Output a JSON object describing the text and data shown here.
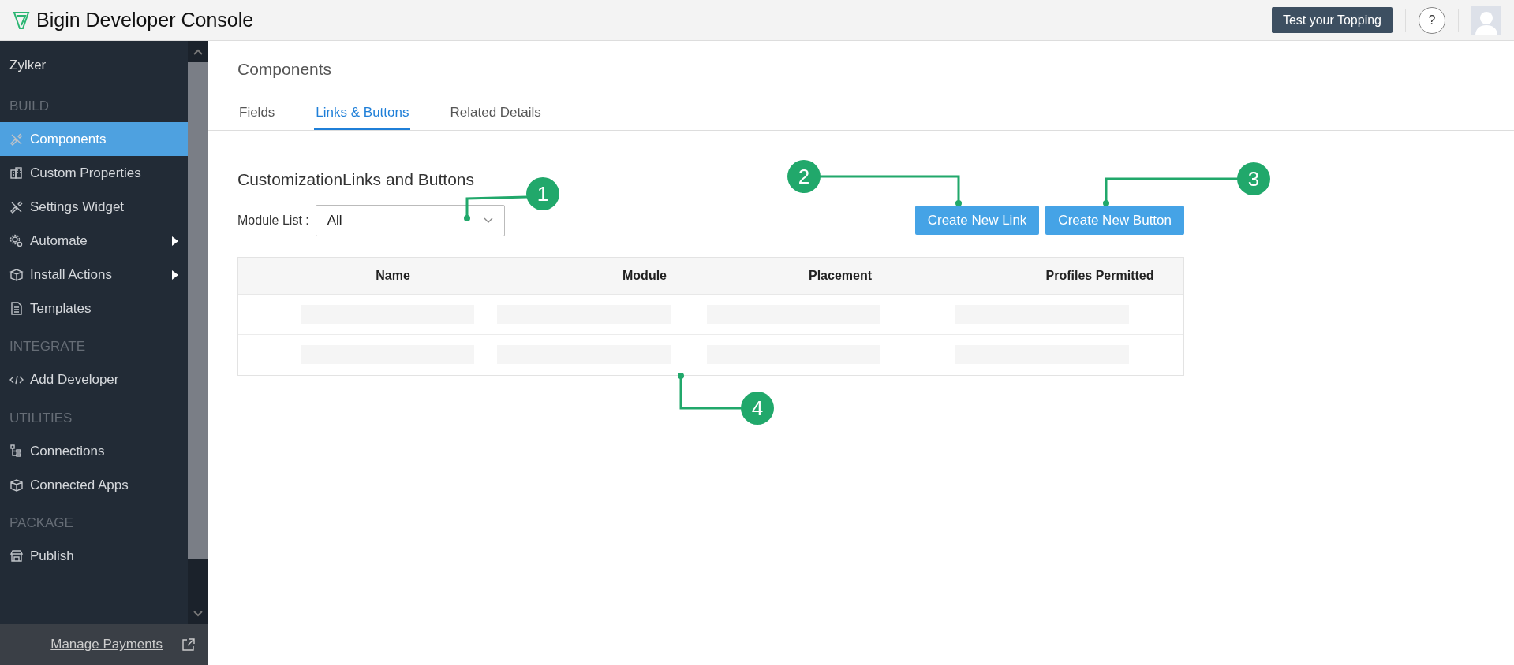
{
  "app": {
    "title": "Bigin Developer Console",
    "test_button": "Test your Topping",
    "help_button": "?"
  },
  "sidebar": {
    "org": "Zylker",
    "sections": [
      {
        "heading": "BUILD",
        "items": [
          {
            "label": "Components",
            "kind": "tools",
            "selected": true,
            "submenu": false
          },
          {
            "label": "Custom Properties",
            "kind": "building",
            "selected": false,
            "submenu": false
          },
          {
            "label": "Settings Widget",
            "kind": "tools",
            "selected": false,
            "submenu": false
          },
          {
            "label": "Automate",
            "kind": "gears",
            "selected": false,
            "submenu": true
          },
          {
            "label": "Install Actions",
            "kind": "box",
            "selected": false,
            "submenu": true
          },
          {
            "label": "Templates",
            "kind": "document",
            "selected": false,
            "submenu": false
          }
        ]
      },
      {
        "heading": "INTEGRATE",
        "items": [
          {
            "label": "Add Developer",
            "kind": "code",
            "selected": false,
            "submenu": false
          }
        ]
      },
      {
        "heading": "UTILITIES",
        "items": [
          {
            "label": "Connections",
            "kind": "tree",
            "selected": false,
            "submenu": false
          },
          {
            "label": "Connected Apps",
            "kind": "cube",
            "selected": false,
            "submenu": false
          }
        ]
      },
      {
        "heading": "PACKAGE",
        "items": [
          {
            "label": "Publish",
            "kind": "store",
            "selected": false,
            "submenu": false
          }
        ]
      }
    ],
    "footer_link": "Manage Payments"
  },
  "page": {
    "title": "Components",
    "tabs": [
      {
        "label": "Fields",
        "selected": false
      },
      {
        "label": "Links & Buttons",
        "selected": true
      },
      {
        "label": "Related Details",
        "selected": false
      }
    ],
    "section_title": "CustomizationLinks and Buttons",
    "module_filter": {
      "label": "Module List :",
      "value": "All"
    },
    "buttons": [
      "Create New Link",
      "Create New Button"
    ],
    "table": {
      "columns": [
        "Name",
        "Module",
        "Placement",
        "Profiles Permitted"
      ],
      "rows": [
        {
          "loading": true
        },
        {
          "loading": true
        }
      ]
    }
  },
  "callouts": [
    {
      "number": "1"
    },
    {
      "number": "2"
    },
    {
      "number": "3"
    },
    {
      "number": "4"
    }
  ]
}
